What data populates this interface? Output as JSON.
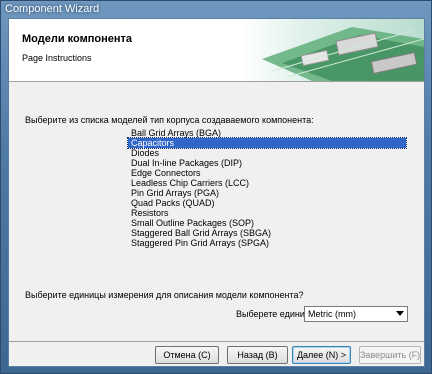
{
  "window": {
    "title": "Component Wizard"
  },
  "header": {
    "title": "Модели компонента",
    "subtitle": "Page Instructions"
  },
  "main": {
    "instruction": "Выберите из списка моделей тип корпуса создаваемого компонента:",
    "package_types": [
      "Ball Grid Arrays (BGA)",
      "Capacitors",
      "Diodes",
      "Dual In-line Packages (DIP)",
      "Edge Connectors",
      "Leadless Chip Carriers (LCC)",
      "Pin Grid Arrays (PGA)",
      "Quad Packs (QUAD)",
      "Resistors",
      "Small Outline Packages (SOP)",
      "Staggered Ball Grid Arrays (SBGA)",
      "Staggered Pin Grid Arrays (SPGA)"
    ],
    "selected_index": 1,
    "units_prompt": "Выберите единицы измерения для описания модели компонента?",
    "units_label": "Выберете единицы",
    "units_value": "Metric (mm)"
  },
  "buttons": {
    "cancel": "Отмена (С)",
    "back": "Назад (В)",
    "next": "Далее (N) >",
    "finish": "Завершить (F)"
  },
  "colors": {
    "selection": "#3066c8",
    "accent_border": "#3c7fb1"
  }
}
